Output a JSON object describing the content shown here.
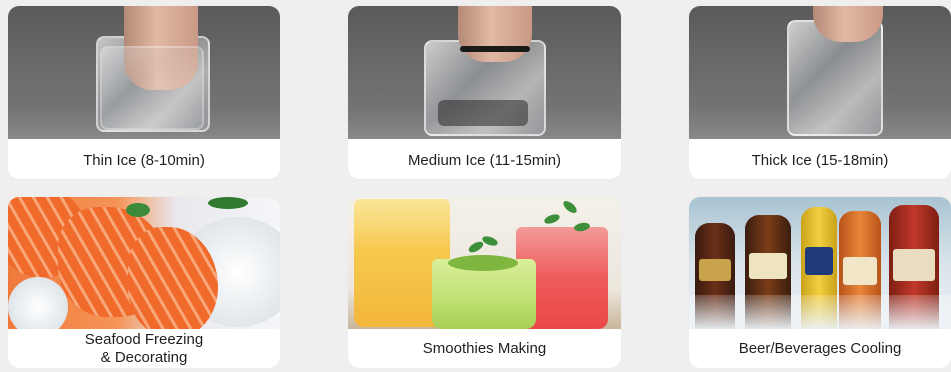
{
  "cards": [
    {
      "caption_lines": [
        "Thin Ice (8-10min)"
      ]
    },
    {
      "caption_lines": [
        "Medium Ice (11-15min)"
      ]
    },
    {
      "caption_lines": [
        "Thick Ice (15-18min)"
      ]
    },
    {
      "caption_lines": [
        "Seafood Freezing",
        "& Decorating"
      ]
    },
    {
      "caption_lines": [
        "Smoothies Making"
      ]
    },
    {
      "caption_lines": [
        "Beer/Beverages Cooling"
      ]
    }
  ]
}
